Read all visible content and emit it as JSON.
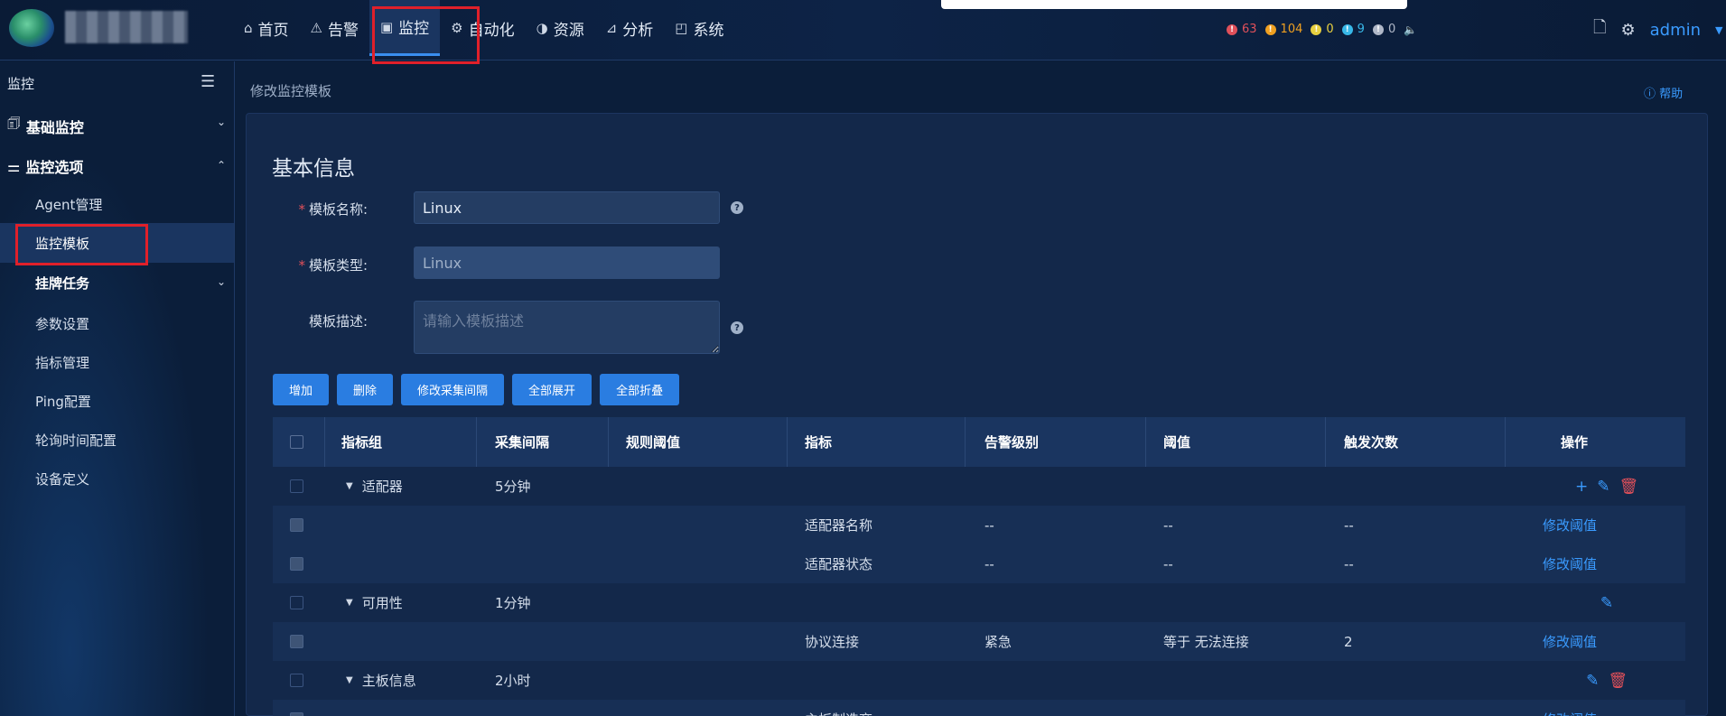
{
  "nav": {
    "items": [
      {
        "icon": "home-icon",
        "glyph": "⌂",
        "label": "首页"
      },
      {
        "icon": "alert-icon",
        "glyph": "⚠",
        "label": "告警"
      },
      {
        "icon": "monitor-icon",
        "glyph": "▣",
        "label": "监控",
        "active": true
      },
      {
        "icon": "gear-automation-icon",
        "glyph": "⚙",
        "label": "自动化"
      },
      {
        "icon": "resource-icon",
        "glyph": "◑",
        "label": "资源"
      },
      {
        "icon": "chart-icon",
        "glyph": "⊿",
        "label": "分析"
      },
      {
        "icon": "system-icon",
        "glyph": "◰",
        "label": "系统"
      }
    ]
  },
  "alerts": [
    {
      "color": "#e0505a",
      "count": "63"
    },
    {
      "color": "#f0a020",
      "count": "104"
    },
    {
      "color": "#e8d040",
      "count": "0"
    },
    {
      "color": "#38b8e8",
      "count": "9"
    },
    {
      "color": "#b0b8c8",
      "count": "0"
    }
  ],
  "user": {
    "name": "admin"
  },
  "sidebar": {
    "title": "监控",
    "groups": [
      {
        "label": "基础监控",
        "chev": "⌄"
      },
      {
        "label": "监控选项",
        "chev": "⌃"
      }
    ],
    "items": [
      "Agent管理",
      "监控模板",
      "挂牌任务",
      "参数设置",
      "指标管理",
      "Ping配置",
      "轮询时间配置",
      "设备定义"
    ]
  },
  "breadcrumb": "修改监控模板",
  "help_label": "帮助",
  "form": {
    "section_title": "基本信息",
    "name_label": "模板名称:",
    "name_value": "Linux",
    "type_label": "模板类型:",
    "type_value": "Linux",
    "desc_label": "模板描述:",
    "desc_placeholder": "请输入模板描述"
  },
  "buttons": [
    "增加",
    "删除",
    "修改采集间隔",
    "全部展开",
    "全部折叠"
  ],
  "table": {
    "headers": [
      "指标组",
      "采集间隔",
      "规则阈值",
      "指标",
      "告警级别",
      "阈值",
      "触发次数",
      "操作"
    ],
    "rows": [
      {
        "type": "group",
        "group": "适配器",
        "interval": "5分钟",
        "actions": [
          "add",
          "edit",
          "delete"
        ]
      },
      {
        "type": "child",
        "metric": "适配器名称",
        "level": "--",
        "threshold": "--",
        "trigger": "--",
        "op": "修改阈值"
      },
      {
        "type": "child",
        "metric": "适配器状态",
        "level": "--",
        "threshold": "--",
        "trigger": "--",
        "op": "修改阈值"
      },
      {
        "type": "group",
        "group": "可用性",
        "interval": "1分钟",
        "actions": [
          "edit"
        ]
      },
      {
        "type": "child",
        "metric": "协议连接",
        "level": "紧急",
        "threshold": "等于 无法连接",
        "trigger": "2",
        "op": "修改阈值"
      },
      {
        "type": "group",
        "group": "主板信息",
        "interval": "2小时",
        "actions": [
          "edit",
          "delete"
        ]
      },
      {
        "type": "child",
        "metric": "主板制造商",
        "level": "",
        "threshold": "",
        "trigger": "",
        "op": "修改阈值"
      }
    ]
  }
}
